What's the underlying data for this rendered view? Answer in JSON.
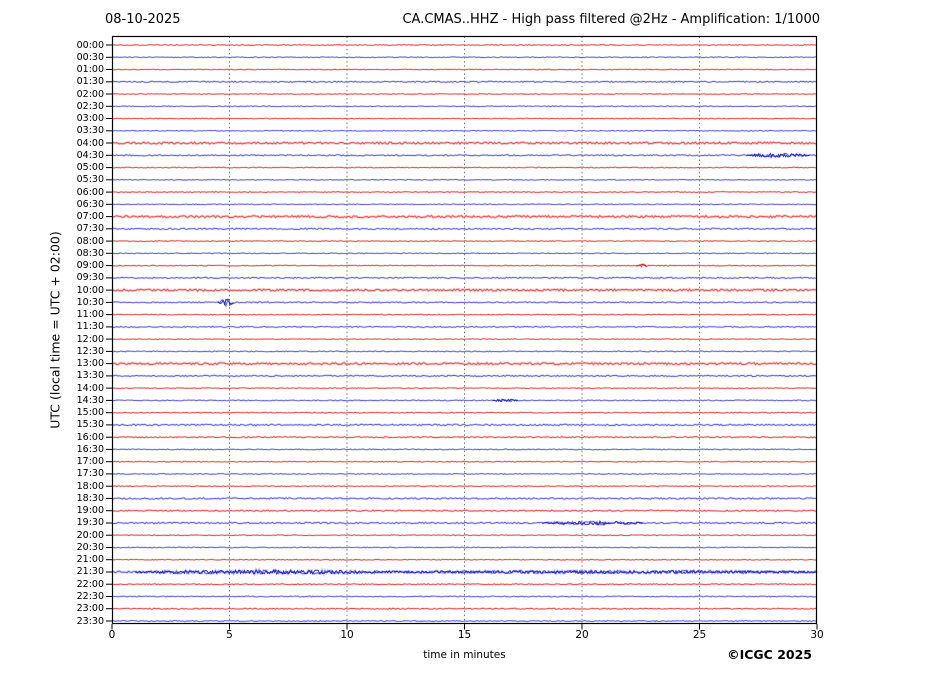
{
  "header": {
    "date": "08-10-2025",
    "title": "CA.CMAS..HHZ - High pass filtered @2Hz - Amplification: 1/1000"
  },
  "footer": {
    "copyright": "©ICGC 2025"
  },
  "chart_data": {
    "type": "line",
    "subtype": "helicorder-seismogram",
    "date": "08-10-2025",
    "title": "CA.CMAS..HHZ - High pass filtered @2Hz - Amplification: 1/1000",
    "xlabel": "time in minutes",
    "ylabel": "UTC (local time = UTC + 02:00)",
    "xlim": [
      0,
      30
    ],
    "x_ticks": [
      0,
      5,
      10,
      15,
      20,
      25,
      30
    ],
    "grid_minutes": [
      5,
      10,
      15,
      20,
      25
    ],
    "grid": "vertical-dotted",
    "colors": {
      "red": "#f08383",
      "red_core": "#e04848",
      "red_event": "#c81e1e",
      "blue": "#9a9aef",
      "blue_core": "#5a5ad8",
      "blue_event": "#1e1ec8",
      "grid": "#6e6e6e",
      "axis": "#000000"
    },
    "rows": [
      {
        "time": "00:00",
        "color": "red",
        "noise": 0.4,
        "events": []
      },
      {
        "time": "00:30",
        "color": "blue",
        "noise": 0.4,
        "events": []
      },
      {
        "time": "01:00",
        "color": "red",
        "noise": 0.35,
        "events": []
      },
      {
        "time": "01:30",
        "color": "blue",
        "noise": 0.6,
        "events": []
      },
      {
        "time": "02:00",
        "color": "red",
        "noise": 0.35,
        "events": []
      },
      {
        "time": "02:30",
        "color": "blue",
        "noise": 0.4,
        "events": []
      },
      {
        "time": "03:00",
        "color": "red",
        "noise": 0.35,
        "events": []
      },
      {
        "time": "03:30",
        "color": "blue",
        "noise": 0.4,
        "events": []
      },
      {
        "time": "04:00",
        "color": "red",
        "noise": 0.95,
        "events": []
      },
      {
        "time": "04:30",
        "color": "blue",
        "noise": 0.6,
        "events": [
          {
            "start": 27.0,
            "end": 29.7,
            "amp": 1.3
          }
        ]
      },
      {
        "time": "05:00",
        "color": "red",
        "noise": 0.4,
        "events": []
      },
      {
        "time": "05:30",
        "color": "blue",
        "noise": 0.4,
        "events": []
      },
      {
        "time": "06:00",
        "color": "red",
        "noise": 0.45,
        "events": []
      },
      {
        "time": "06:30",
        "color": "blue",
        "noise": 0.4,
        "events": []
      },
      {
        "time": "07:00",
        "color": "red",
        "noise": 0.95,
        "events": []
      },
      {
        "time": "07:30",
        "color": "blue",
        "noise": 0.65,
        "events": []
      },
      {
        "time": "08:00",
        "color": "red",
        "noise": 0.4,
        "events": []
      },
      {
        "time": "08:30",
        "color": "blue",
        "noise": 0.4,
        "events": []
      },
      {
        "time": "09:00",
        "color": "red",
        "noise": 0.4,
        "events": [
          {
            "start": 22.3,
            "end": 22.8,
            "amp": 1.2
          }
        ]
      },
      {
        "time": "09:30",
        "color": "blue",
        "noise": 0.6,
        "events": []
      },
      {
        "time": "10:00",
        "color": "red",
        "noise": 0.95,
        "events": []
      },
      {
        "time": "10:30",
        "color": "blue",
        "noise": 0.6,
        "events": [
          {
            "start": 4.5,
            "end": 5.2,
            "amp": 3.0
          }
        ]
      },
      {
        "time": "11:00",
        "color": "red",
        "noise": 0.4,
        "events": []
      },
      {
        "time": "11:30",
        "color": "blue",
        "noise": 0.55,
        "events": []
      },
      {
        "time": "12:00",
        "color": "red",
        "noise": 0.35,
        "events": []
      },
      {
        "time": "12:30",
        "color": "blue",
        "noise": 0.45,
        "events": []
      },
      {
        "time": "13:00",
        "color": "red",
        "noise": 0.95,
        "events": []
      },
      {
        "time": "13:30",
        "color": "blue",
        "noise": 0.65,
        "events": []
      },
      {
        "time": "14:00",
        "color": "red",
        "noise": 0.35,
        "events": []
      },
      {
        "time": "14:30",
        "color": "blue",
        "noise": 0.45,
        "events": [
          {
            "start": 16.2,
            "end": 17.3,
            "amp": 0.9
          }
        ]
      },
      {
        "time": "15:00",
        "color": "red",
        "noise": 0.4,
        "events": []
      },
      {
        "time": "15:30",
        "color": "blue",
        "noise": 0.7,
        "events": []
      },
      {
        "time": "16:00",
        "color": "red",
        "noise": 0.55,
        "events": []
      },
      {
        "time": "16:30",
        "color": "blue",
        "noise": 0.45,
        "events": []
      },
      {
        "time": "17:00",
        "color": "red",
        "noise": 0.4,
        "events": []
      },
      {
        "time": "17:30",
        "color": "blue",
        "noise": 0.4,
        "events": []
      },
      {
        "time": "18:00",
        "color": "red",
        "noise": 0.4,
        "events": []
      },
      {
        "time": "18:30",
        "color": "blue",
        "noise": 0.7,
        "events": []
      },
      {
        "time": "19:00",
        "color": "red",
        "noise": 0.6,
        "events": []
      },
      {
        "time": "19:30",
        "color": "blue",
        "noise": 0.7,
        "events": [
          {
            "start": 18.3,
            "end": 22.6,
            "amp": 1.1
          }
        ]
      },
      {
        "time": "20:00",
        "color": "red",
        "noise": 0.4,
        "events": []
      },
      {
        "time": "20:30",
        "color": "blue",
        "noise": 0.4,
        "events": []
      },
      {
        "time": "21:00",
        "color": "red",
        "noise": 0.4,
        "events": []
      },
      {
        "time": "21:30",
        "color": "blue",
        "noise": 1.0,
        "events": [
          {
            "start": 1.0,
            "end": 12.0,
            "amp": 1.1
          },
          {
            "start": 12.0,
            "end": 30.0,
            "amp": 0.55
          }
        ]
      },
      {
        "time": "22:00",
        "color": "red",
        "noise": 0.5,
        "events": []
      },
      {
        "time": "22:30",
        "color": "blue",
        "noise": 0.45,
        "events": []
      },
      {
        "time": "23:00",
        "color": "red",
        "noise": 0.5,
        "events": []
      },
      {
        "time": "23:30",
        "color": "blue",
        "noise": 0.45,
        "events": []
      }
    ]
  }
}
